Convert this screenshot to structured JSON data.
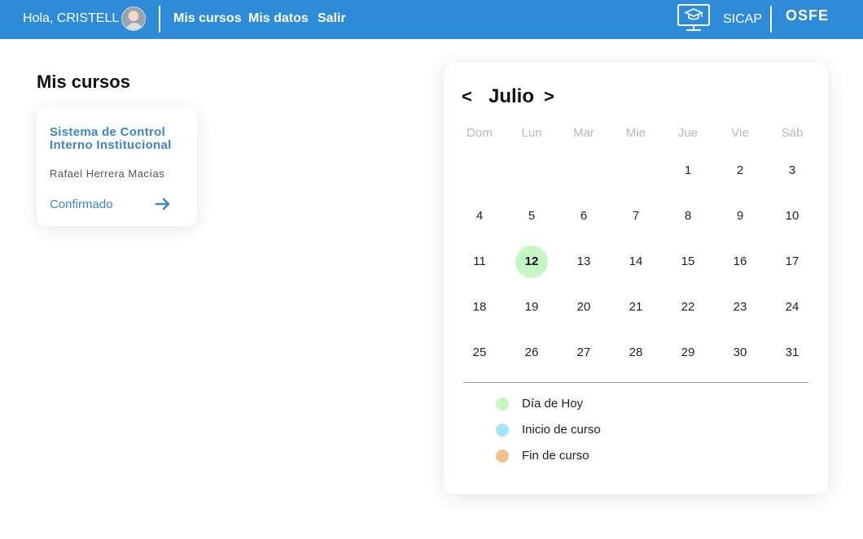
{
  "header": {
    "greeting": "Hola, CRISTELL",
    "nav": [
      "Mis cursos",
      "Mis datos",
      "Salir"
    ],
    "system_label": "SICAP",
    "brand": "OSFE",
    "background_color": "#2e8bd8"
  },
  "courses": {
    "title": "Mis cursos",
    "items": [
      {
        "title_line1": "Sistema de Control",
        "title_line2": "Interno Institucional",
        "teacher": "Rafael Herrera Macías",
        "status": "Confirmado",
        "action_icon": "arrow-right-icon"
      }
    ]
  },
  "calendar": {
    "prev": "<",
    "month": "Julio",
    "next": ">",
    "weekdays": [
      "Dom",
      "Lun",
      "Mar",
      "Mie",
      "Jue",
      "Vie",
      "Sáb"
    ],
    "start_weekday_index": 4,
    "days_in_month": 31,
    "today": 12,
    "today_color": "#c5f7c5",
    "legend": [
      {
        "label": "Día de Hoy",
        "color": "#c5f7c5"
      },
      {
        "label": "Inicio de curso",
        "color": "#a3e6f7"
      },
      {
        "label": "Fin de curso",
        "color": "#f5c089"
      }
    ]
  }
}
